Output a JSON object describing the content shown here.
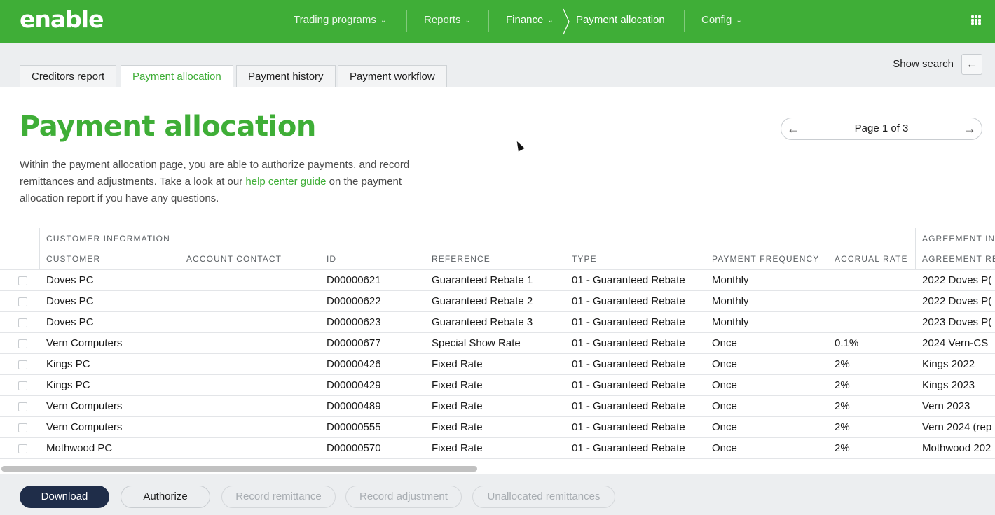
{
  "brand": {
    "logo_text": "enable",
    "accent": "#3fae37",
    "primary_button": "#1f2d49"
  },
  "nav": {
    "items": [
      {
        "label": "Trading programs",
        "dropdown": true
      },
      {
        "label": "Reports",
        "dropdown": true
      },
      {
        "label": "Finance",
        "dropdown": true
      },
      {
        "label": "Payment allocation",
        "dropdown": false
      },
      {
        "label": "Config",
        "dropdown": true
      }
    ],
    "apps_icon": "grid-icon"
  },
  "tabs": [
    {
      "label": "Creditors report",
      "active": false
    },
    {
      "label": "Payment allocation",
      "active": true
    },
    {
      "label": "Payment history",
      "active": false
    },
    {
      "label": "Payment workflow",
      "active": false
    }
  ],
  "search_toggle": {
    "label": "Show search",
    "icon": "arrow-left-icon"
  },
  "page": {
    "title": "Payment allocation",
    "desc_before": "Within the payment allocation page, you are able to authorize payments, and record remittances and adjustments. Take a look at our ",
    "desc_link": "help center guide",
    "desc_after": " on the payment allocation report if you have any questions."
  },
  "pager": {
    "label": "Page 1 of 3"
  },
  "table": {
    "groups": [
      "CUSTOMER INFORMATION",
      "AGREEMENT IN"
    ],
    "columns": [
      "CUSTOMER",
      "ACCOUNT CONTACT",
      "ID",
      "REFERENCE",
      "TYPE",
      "PAYMENT FREQUENCY",
      "ACCRUAL RATE",
      "AGREEMENT RE"
    ],
    "rows": [
      [
        "Doves PC",
        "",
        "D00000621",
        "Guaranteed Rebate 1",
        "01 - Guaranteed Rebate",
        "Monthly",
        "",
        "2022 Doves P("
      ],
      [
        "Doves PC",
        "",
        "D00000622",
        "Guaranteed Rebate 2",
        "01 - Guaranteed Rebate",
        "Monthly",
        "",
        "2022 Doves P("
      ],
      [
        "Doves PC",
        "",
        "D00000623",
        "Guaranteed Rebate 3",
        "01 - Guaranteed Rebate",
        "Monthly",
        "",
        "2023 Doves P("
      ],
      [
        "Vern Computers",
        "",
        "D00000677",
        "Special Show Rate",
        "01 - Guaranteed Rebate",
        "Once",
        "0.1%",
        "2024 Vern-CS"
      ],
      [
        "Kings PC",
        "",
        "D00000426",
        "Fixed Rate",
        "01 - Guaranteed Rebate",
        "Once",
        "2%",
        "Kings 2022"
      ],
      [
        "Kings PC",
        "",
        "D00000429",
        "Fixed Rate",
        "01 - Guaranteed Rebate",
        "Once",
        "2%",
        "Kings 2023"
      ],
      [
        "Vern Computers",
        "",
        "D00000489",
        "Fixed Rate",
        "01 - Guaranteed Rebate",
        "Once",
        "2%",
        "Vern 2023"
      ],
      [
        "Vern Computers",
        "",
        "D00000555",
        "Fixed Rate",
        "01 - Guaranteed Rebate",
        "Once",
        "2%",
        "Vern 2024 (rep"
      ],
      [
        "Mothwood PC",
        "",
        "D00000570",
        "Fixed Rate",
        "01 - Guaranteed Rebate",
        "Once",
        "2%",
        "Mothwood 202"
      ]
    ]
  },
  "footer": {
    "buttons": [
      {
        "label": "Download",
        "state": "primary"
      },
      {
        "label": "Authorize",
        "state": "enabled"
      },
      {
        "label": "Record remittance",
        "state": "disabled"
      },
      {
        "label": "Record adjustment",
        "state": "disabled"
      },
      {
        "label": "Unallocated remittances",
        "state": "disabled"
      }
    ]
  }
}
